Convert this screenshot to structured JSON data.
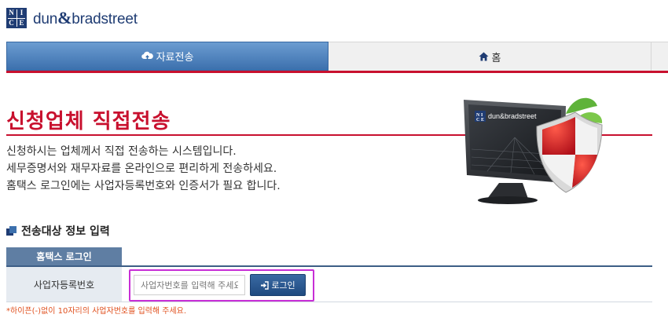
{
  "logo": {
    "mark_letters": [
      "N",
      "I",
      "C",
      "E"
    ],
    "brand_dun": "dun",
    "brand_amp": "&",
    "brand_bradstreet": "bradstreet"
  },
  "nav": {
    "upload_label": "자료전송",
    "home_label": "홈",
    "upload_icon": "upload-icon",
    "home_icon": "home-icon"
  },
  "page": {
    "title": "신청업체 직접전송",
    "intro": [
      "신청하시는 업체께서 직접 전송하는 시스템입니다.",
      "세무증명서와 재무자료를 온라인으로 편리하게 전송하세요.",
      "홈택스 로그인에는 사업자등록번호와 인증서가 필요 합니다."
    ]
  },
  "illustration": {
    "screen_brand": "dun&bradstreet",
    "screen_mark": [
      "N",
      "I",
      "C",
      "E"
    ]
  },
  "section": {
    "heading": "전송대상 정보 입력"
  },
  "login": {
    "tab_label": "홈택스 로그인",
    "field_label": "사업자등록번호",
    "input_placeholder": "사업자번호를 입력해 주세요",
    "input_value": "",
    "button_label": "로그인",
    "note": "*하이픈(-)없이 10자리의 사업자번호를 입력해 주세요."
  },
  "colors": {
    "accent_red": "#c8102e",
    "brand_navy": "#1f3c73",
    "tab_blue": "#3c70ad",
    "highlight": "#c72ed6",
    "note_orange": "#e0501e"
  }
}
